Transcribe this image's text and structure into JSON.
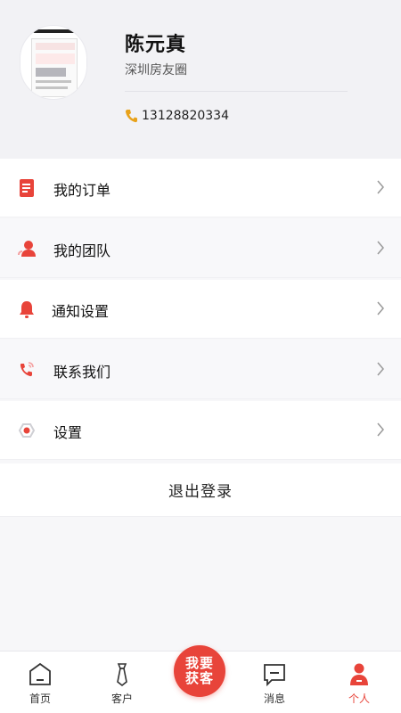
{
  "profile": {
    "name": "陈元真",
    "org": "深圳房友圈",
    "phone": "13128820334"
  },
  "menu": [
    {
      "label": "我的订单",
      "icon": "order-list-icon"
    },
    {
      "label": "我的团队",
      "icon": "team-user-icon"
    },
    {
      "label": "通知设置",
      "icon": "bell-icon"
    },
    {
      "label": "联系我们",
      "icon": "phone-call-icon"
    },
    {
      "label": "设置",
      "icon": "settings-hexagon-icon"
    }
  ],
  "logout_label": "退出登录",
  "tabs": [
    {
      "label": "首页",
      "icon": "home-icon"
    },
    {
      "label": "客户",
      "icon": "necktie-icon"
    },
    {
      "label": "消息",
      "icon": "message-icon"
    },
    {
      "label": "个人",
      "icon": "person-icon",
      "active": true
    }
  ],
  "fab": {
    "line1": "我要",
    "line2": "获客"
  },
  "colors": {
    "accent": "#e8443a",
    "phone_icon": "#e8a21a",
    "background": "#f7f7f9"
  }
}
